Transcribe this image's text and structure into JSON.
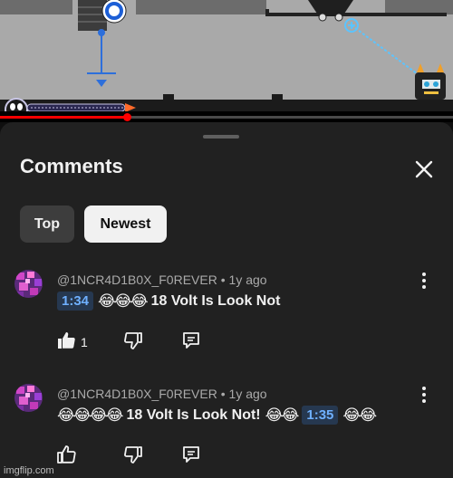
{
  "video": {
    "progress_fraction": 0.28,
    "colors": {
      "scene": "#a9a9a9",
      "progress": "#ff0000",
      "track": "#4a4a4a"
    }
  },
  "comments_panel": {
    "title": "Comments",
    "close_icon": "close-icon",
    "filters": [
      {
        "label": "Top",
        "selected": false
      },
      {
        "label": "Newest",
        "selected": true
      }
    ],
    "comments": [
      {
        "author": "@1NCR4D1B0X_F0REVER",
        "age": "1y ago",
        "segments": [
          {
            "type": "timestamp",
            "text": "1:34"
          },
          {
            "type": "emoji",
            "text": "😂😂😂"
          },
          {
            "type": "text",
            "text": "18 Volt Is Look Not"
          }
        ],
        "likes": "1"
      },
      {
        "author": "@1NCR4D1B0X_F0REVER",
        "age": "1y ago",
        "segments": [
          {
            "type": "emoji",
            "text": "😂😂😂😂"
          },
          {
            "type": "text",
            "text": "18 Volt Is Look Not!"
          },
          {
            "type": "emoji",
            "text": "😂😂"
          },
          {
            "type": "timestamp",
            "text": "1:35"
          },
          {
            "type": "emoji",
            "text": "😂😂"
          }
        ],
        "likes": ""
      }
    ]
  },
  "watermark": "imgflip.com",
  "colors": {
    "background": "#0f0f0f",
    "sheet": "#212121",
    "chip_selected": "#f1f1f1",
    "chip_unselected": "#3d3d3d",
    "timestamp_bg": "#263850",
    "timestamp_text": "#6fb0ff",
    "meta_text": "#aaaaaa"
  }
}
